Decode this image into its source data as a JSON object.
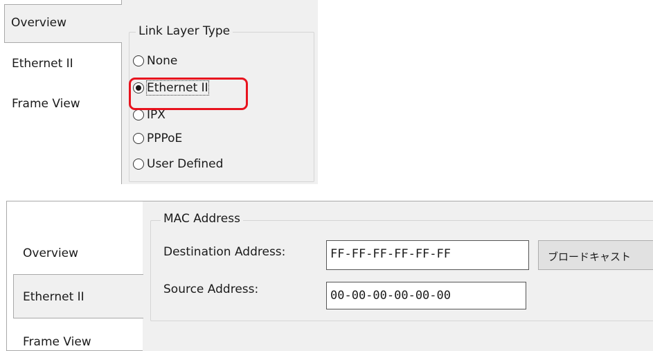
{
  "top_panel": {
    "tabs": [
      {
        "label": "Overview"
      },
      {
        "label": "Ethernet II"
      },
      {
        "label": "Frame View"
      }
    ],
    "link_layer": {
      "legend": "Link Layer Type",
      "options": [
        {
          "label": "None",
          "checked": false
        },
        {
          "label": "Ethernet II",
          "checked": true
        },
        {
          "label": "IPX",
          "checked": false
        },
        {
          "label": "PPPoE",
          "checked": false
        },
        {
          "label": "User Defined",
          "checked": false
        }
      ]
    },
    "highlight_color": "#e8131e"
  },
  "bottom_panel": {
    "tabs": [
      {
        "label": "Overview"
      },
      {
        "label": "Ethernet II"
      },
      {
        "label": "Frame View"
      }
    ],
    "mac": {
      "legend": "MAC Address",
      "destination_label": "Destination Address:",
      "destination_value": "FF-FF-FF-FF-FF-FF",
      "source_label": "Source Address:",
      "source_value": "00-00-00-00-00-00",
      "broadcast_button": "ブロードキャスト"
    }
  }
}
